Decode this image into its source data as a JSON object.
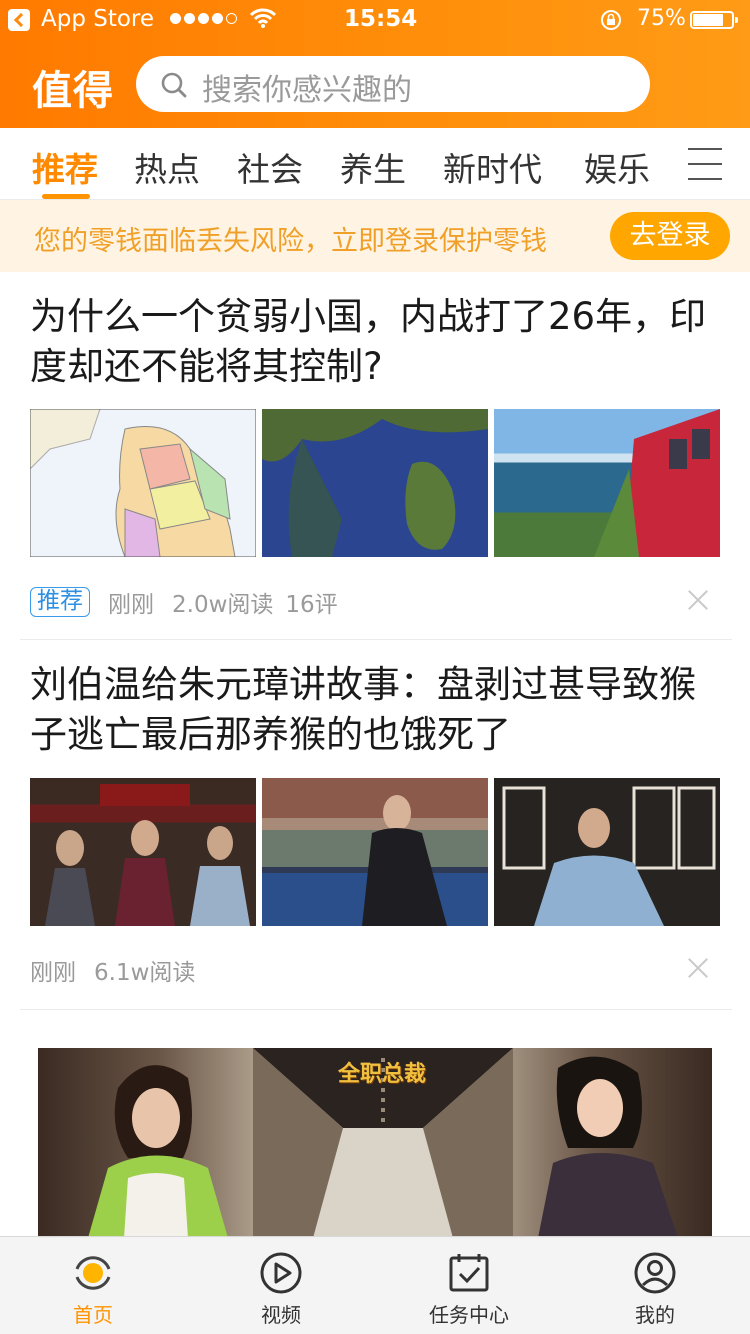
{
  "status_bar": {
    "back_app": "App Store",
    "time": "15:54",
    "battery": "75%"
  },
  "header": {
    "logo": "值得",
    "search_placeholder": "搜索你感兴趣的"
  },
  "tabs": [
    "推荐",
    "热点",
    "社会",
    "养生",
    "新时代",
    "娱乐"
  ],
  "notice": {
    "text": "您的零钱面临丢失风险，立即登录保护零钱",
    "button": "去登录"
  },
  "articles": [
    {
      "title": "为什么一个贫弱小国，内战打了26年，印度却还不能将其控制?",
      "tag": "推荐",
      "time": "刚刚",
      "reads": "2.0w阅读",
      "comments": "16评"
    },
    {
      "title": "刘伯温给朱元璋讲故事：盘剥过甚导致猴子逃亡最后那养猴的也饿死了",
      "time": "刚刚",
      "reads": "6.1w阅读"
    }
  ],
  "ad": {
    "title": "全职总裁"
  },
  "bottom_nav": {
    "items": [
      "首页",
      "视频",
      "任务中心",
      "我的"
    ]
  },
  "colors": {
    "accent": "#ff9400",
    "header": "#ff8a0a",
    "notice_bg": "#fff4e3",
    "tag_blue": "#2f8fe0"
  }
}
